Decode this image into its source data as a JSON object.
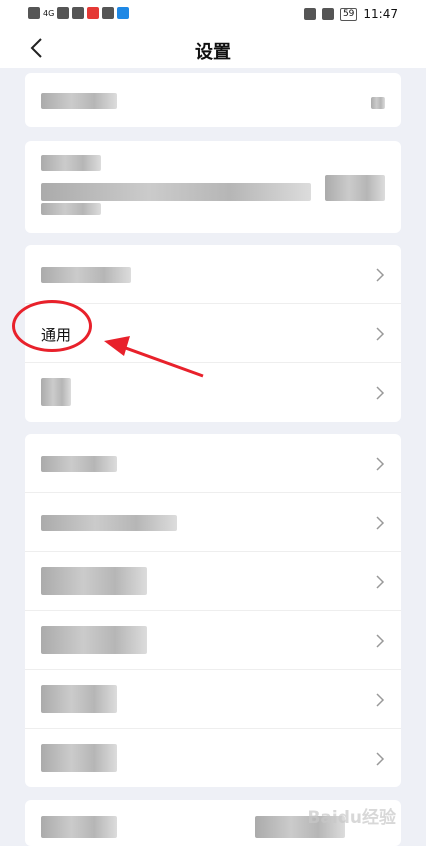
{
  "status_bar": {
    "time": "11:47",
    "battery": "59",
    "network": "4G"
  },
  "header": {
    "title": "设置"
  },
  "rows": {
    "general_label": "通用"
  },
  "annotation": {
    "color": "#e8212b"
  },
  "watermark": {
    "text": "Baidu经验"
  }
}
